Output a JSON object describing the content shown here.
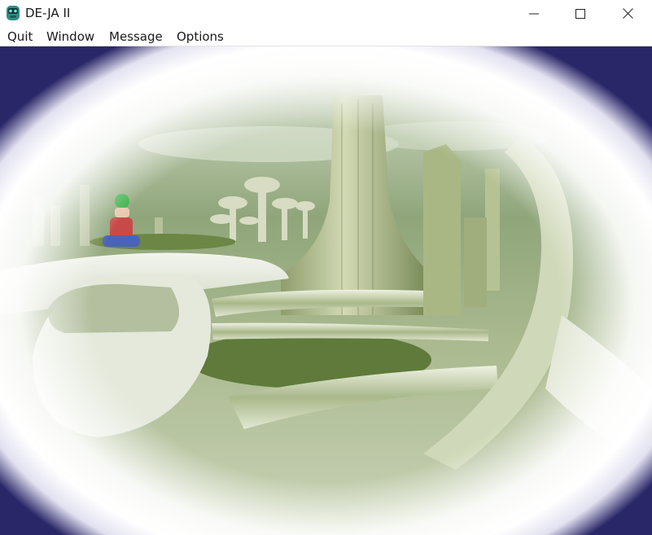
{
  "window": {
    "title": "DE-JA II",
    "icon": "robot-head-icon",
    "controls": [
      "minimize-icon",
      "maximize-icon",
      "close-icon"
    ]
  },
  "menu": {
    "quit": "Quit",
    "window": "Window",
    "message": "Message",
    "options": "Options"
  },
  "scene": {
    "description_icon": "futuristic-city-scene",
    "colors": {
      "vignette_edge": "#2a2768",
      "tint_green": "#6f8a4e",
      "road_pale": "#e9ece2"
    }
  }
}
